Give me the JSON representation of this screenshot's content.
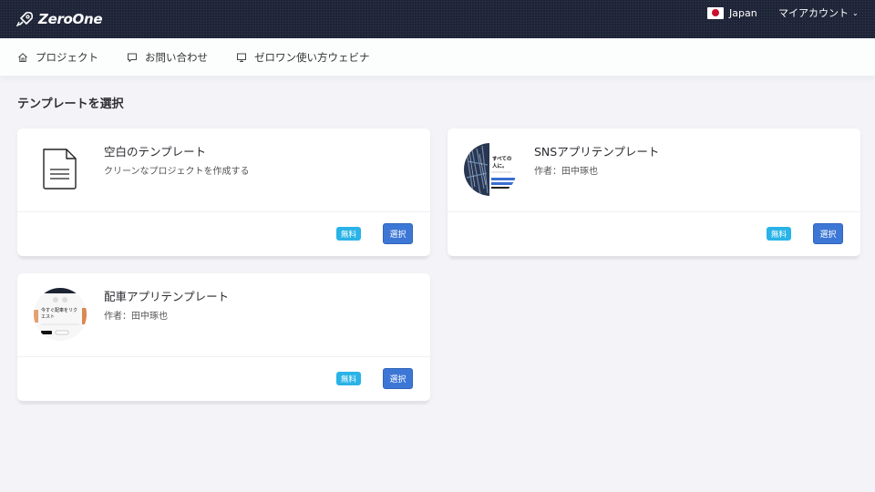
{
  "header": {
    "logo_text": "ZeroOne",
    "language": "Japan",
    "account": "マイアカウント"
  },
  "nav": {
    "items": [
      {
        "label": "プロジェクト",
        "icon": "home-icon"
      },
      {
        "label": "お問い合わせ",
        "icon": "chat-icon"
      },
      {
        "label": "ゼロワン使い方ウェビナ",
        "icon": "monitor-icon"
      }
    ]
  },
  "page": {
    "title": "テンプレートを選択"
  },
  "templates": [
    {
      "title": "空白のテンプレート",
      "subtitle": "クリーンなプロジェクトを作成する",
      "badge": "無料",
      "button": "選択",
      "thumb": "document-icon"
    },
    {
      "title": "SNSアプリテンプレート",
      "subtitle": "作者：田中琢也",
      "badge": "無料",
      "button": "選択",
      "thumb": "sns-app-thumbnail",
      "thumb_text": "すべての人に。"
    },
    {
      "title": "配車アプリテンプレート",
      "subtitle": "作者：田中琢也",
      "badge": "無料",
      "button": "選択",
      "thumb": "ride-app-thumbnail",
      "thumb_text": "今すぐ配車をリクエスト"
    }
  ],
  "colors": {
    "header_bg": "#1f2538",
    "badge": "#29b3e7",
    "button": "#3d77d6",
    "page_bg": "#f4f4f8"
  }
}
